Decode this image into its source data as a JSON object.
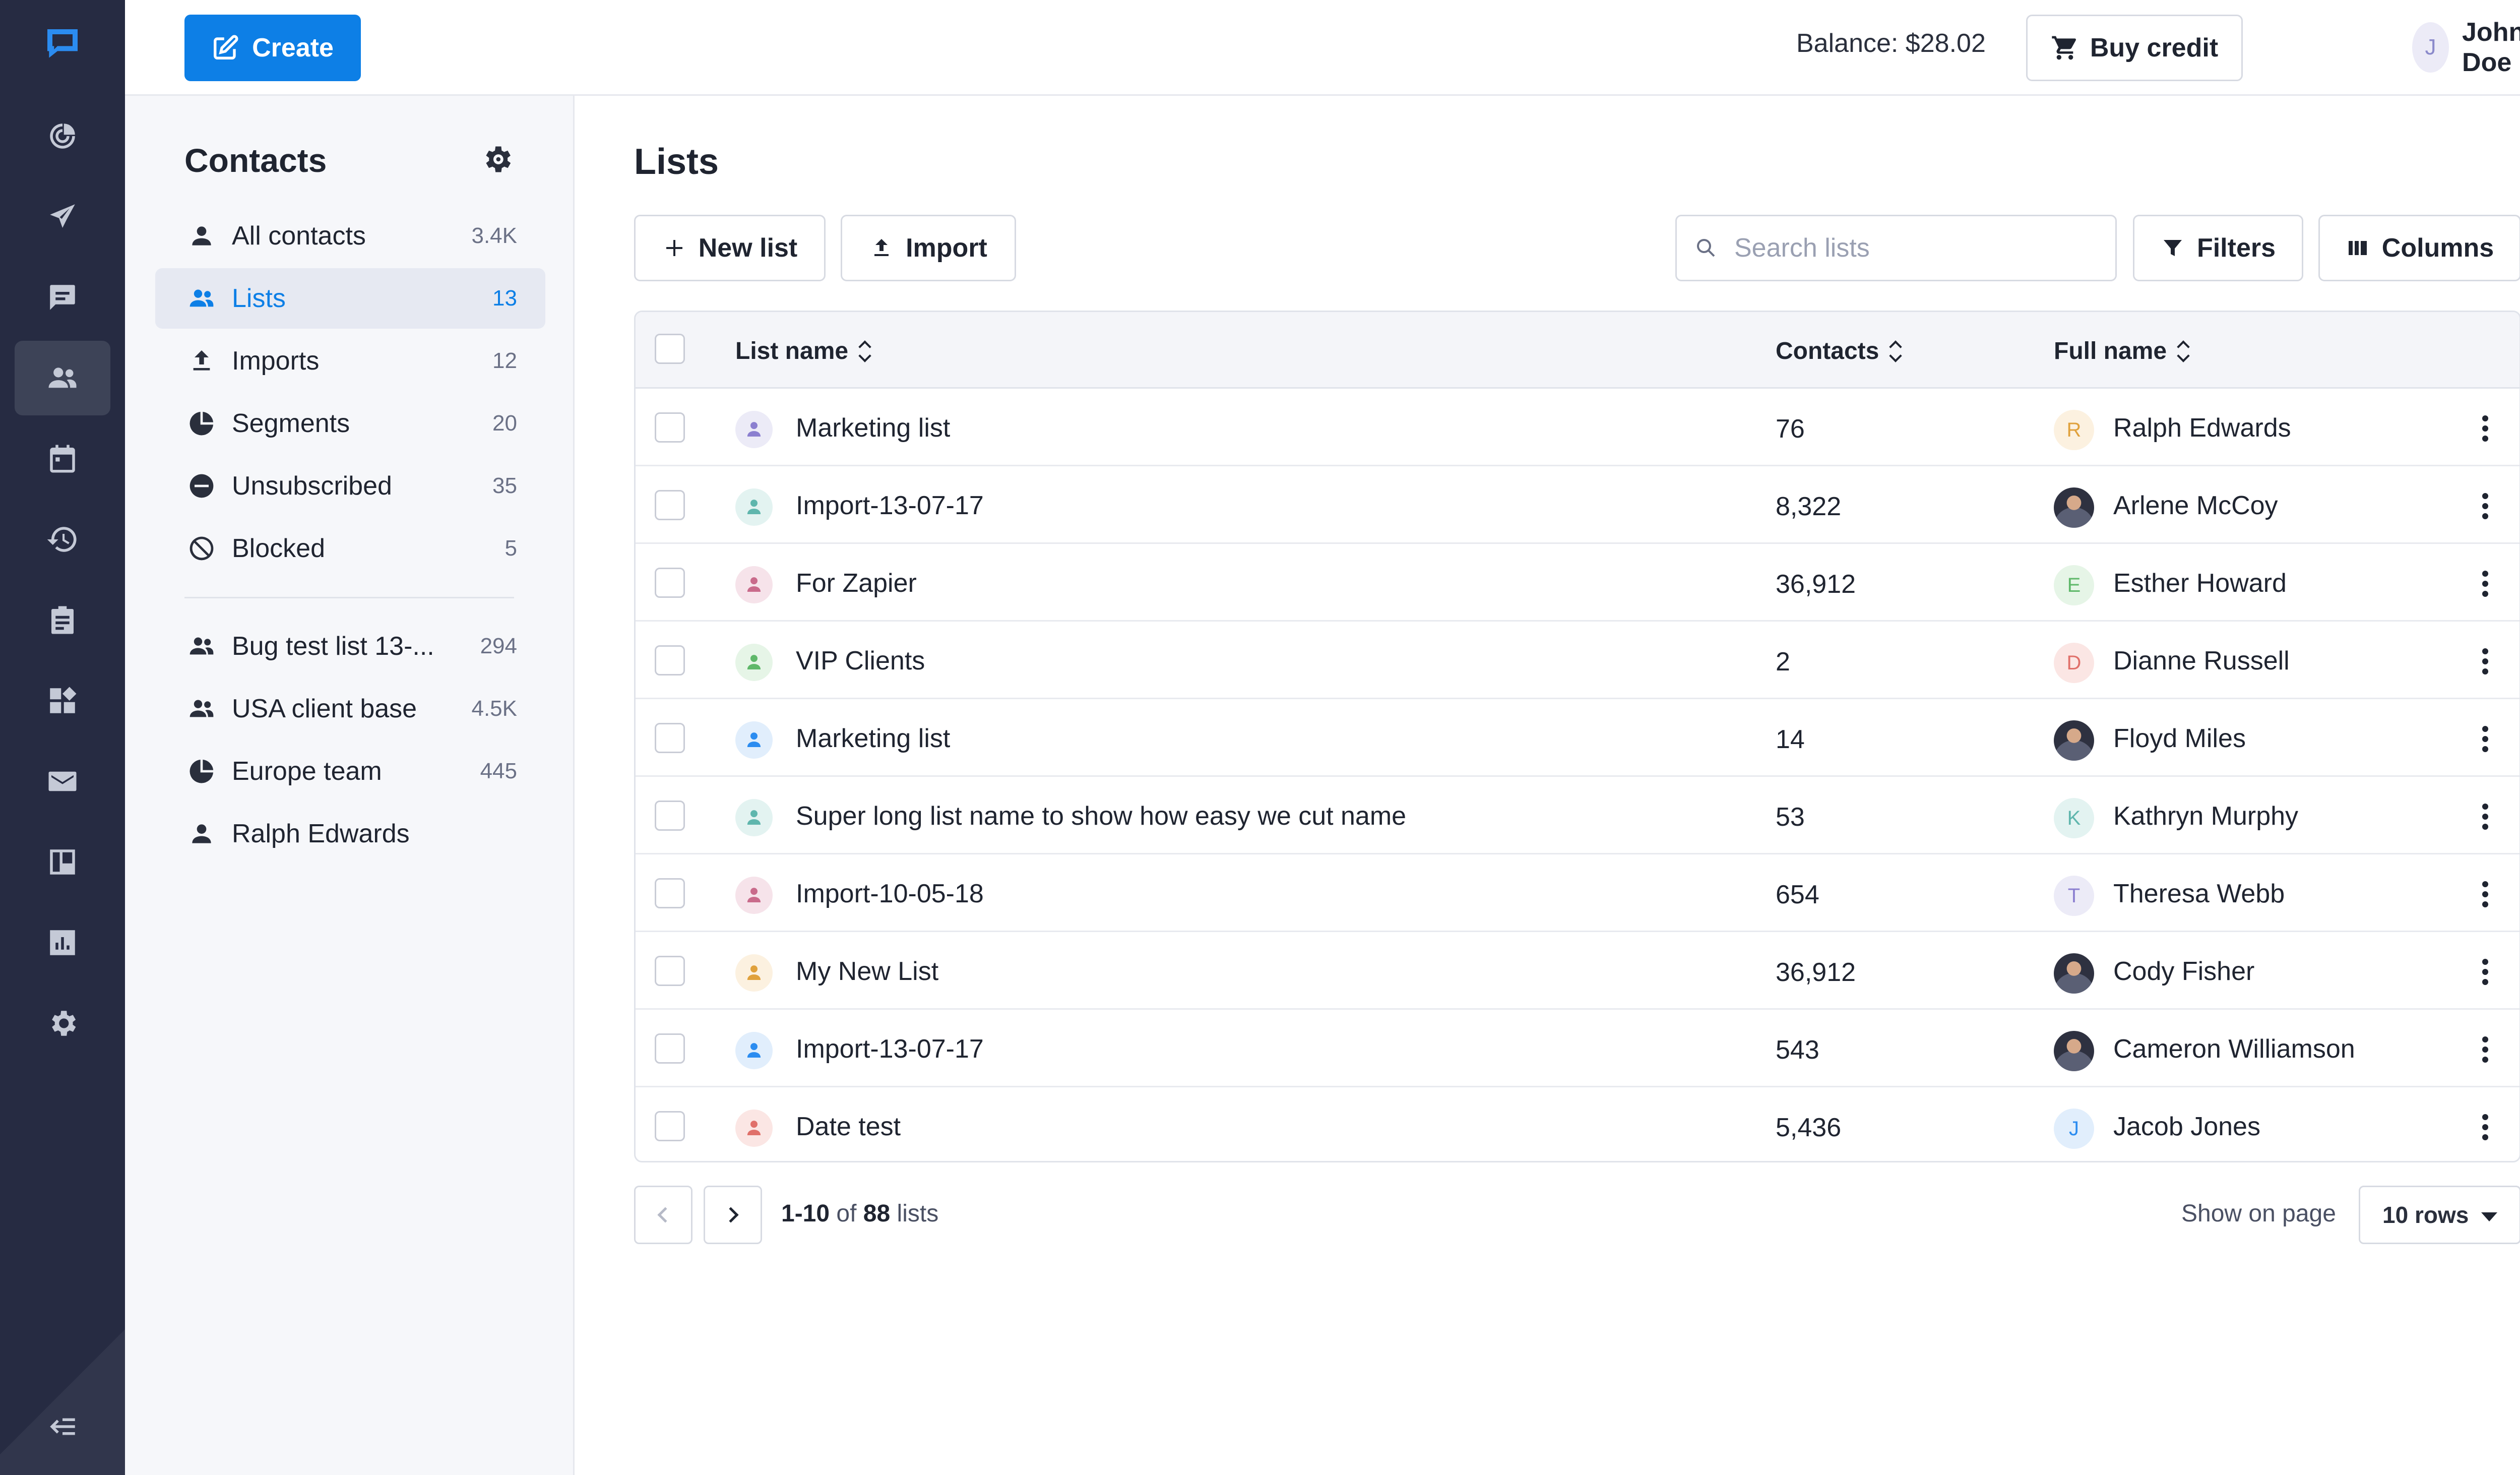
{
  "topbar": {
    "create_label": "Create",
    "balance_label": "Balance: $28.02",
    "buy_credit_label": "Buy credit",
    "user_initial": "J",
    "user_name": "John Doe"
  },
  "rail": {
    "items": [
      "logo-icon",
      "dashboard-icon",
      "send-icon",
      "chat-icon",
      "contacts-icon",
      "calendar-icon",
      "history-icon",
      "clipboard-icon",
      "apps-icon",
      "mail-icon",
      "board-icon",
      "chart-icon",
      "settings-icon",
      "collapse-icon"
    ],
    "active": "contacts-icon"
  },
  "sidebar": {
    "title": "Contacts",
    "items": [
      {
        "label": "All contacts",
        "count": "3.4K",
        "icon": "person-icon"
      },
      {
        "label": "Lists",
        "count": "13",
        "icon": "group-icon"
      },
      {
        "label": "Imports",
        "count": "12",
        "icon": "upload-icon"
      },
      {
        "label": "Segments",
        "count": "20",
        "icon": "pie-icon"
      },
      {
        "label": "Unsubscribed",
        "count": "35",
        "icon": "minus-circle-icon"
      },
      {
        "label": "Blocked",
        "count": "5",
        "icon": "block-icon"
      }
    ],
    "saved": [
      {
        "label": "Bug test list 13-...",
        "count": "294",
        "icon": "group-icon"
      },
      {
        "label": "USA client base",
        "count": "4.5K",
        "icon": "group-icon"
      },
      {
        "label": "Europe team",
        "count": "445",
        "icon": "pie-icon"
      },
      {
        "label": "Ralph Edwards",
        "count": "",
        "icon": "person-icon"
      }
    ]
  },
  "main": {
    "title": "Lists",
    "new_list_label": "New list",
    "import_label": "Import",
    "search_placeholder": "Search lists",
    "filters_label": "Filters",
    "columns_label": "Columns"
  },
  "table": {
    "headers": {
      "list_name": "List name",
      "contacts": "Contacts",
      "full_name": "Full name"
    },
    "rows": [
      {
        "list_name": "Marketing list",
        "contacts": "76",
        "full_name": "Ralph Edwards",
        "initial": "R",
        "icon_color": "#8b7fd0",
        "icon_bg": "#ecebf7",
        "avatar_color": "#e0a13c",
        "avatar_bg": "#fcf1e0",
        "photo": false
      },
      {
        "list_name": "Import-13-07-17",
        "contacts": "8,322",
        "full_name": "Arlene McCoy",
        "initial": "",
        "icon_color": "#5fb6ad",
        "icon_bg": "#e3f3f1",
        "avatar_color": "",
        "avatar_bg": "",
        "photo": true
      },
      {
        "list_name": "For Zapier",
        "contacts": "36,912",
        "full_name": "Esther Howard",
        "initial": "E",
        "icon_color": "#c96b8b",
        "icon_bg": "#f6e3ea",
        "avatar_color": "#5fb86a",
        "avatar_bg": "#e6f5e7",
        "photo": false
      },
      {
        "list_name": "VIP Clients",
        "contacts": "2",
        "full_name": "Dianne Russell",
        "initial": "D",
        "icon_color": "#5fb86a",
        "icon_bg": "#e6f5e7",
        "avatar_color": "#e0706a",
        "avatar_bg": "#fbe6e4",
        "photo": false
      },
      {
        "list_name": "Marketing list",
        "contacts": "14",
        "full_name": "Floyd Miles",
        "initial": "",
        "icon_color": "#2b8cf0",
        "icon_bg": "#e1eefc",
        "avatar_color": "",
        "avatar_bg": "",
        "photo": true
      },
      {
        "list_name": "Super long list name to show how easy we cut name",
        "contacts": "53",
        "full_name": "Kathryn Murphy",
        "initial": "K",
        "icon_color": "#5fb6ad",
        "icon_bg": "#e3f3f1",
        "avatar_color": "#5fb6ad",
        "avatar_bg": "#e3f3f1",
        "photo": false
      },
      {
        "list_name": "Import-10-05-18",
        "contacts": "654",
        "full_name": "Theresa Webb",
        "initial": "T",
        "icon_color": "#c96b8b",
        "icon_bg": "#f6e3ea",
        "avatar_color": "#8b7fd0",
        "avatar_bg": "#ecebf7",
        "photo": false
      },
      {
        "list_name": "My New List",
        "contacts": "36,912",
        "full_name": "Cody Fisher",
        "initial": "",
        "icon_color": "#e0a13c",
        "icon_bg": "#fcf1e0",
        "avatar_color": "",
        "avatar_bg": "",
        "photo": true
      },
      {
        "list_name": "Import-13-07-17",
        "contacts": "543",
        "full_name": "Cameron Williamson",
        "initial": "",
        "icon_color": "#2b8cf0",
        "icon_bg": "#e1eefc",
        "avatar_color": "",
        "avatar_bg": "",
        "photo": true
      },
      {
        "list_name": "Date test",
        "contacts": "5,436",
        "full_name": "Jacob Jones",
        "initial": "J",
        "icon_color": "#e0706a",
        "icon_bg": "#fbe6e4",
        "avatar_color": "#2b8cf0",
        "avatar_bg": "#e1eefc",
        "photo": false
      }
    ]
  },
  "pagination": {
    "range": "1-10",
    "of_label": "of",
    "total": "88",
    "unit": "lists",
    "show_label": "Show on page",
    "rows_value": "10 rows"
  },
  "colors": {
    "accent": "#0d7fe6",
    "rail": "#262b42"
  }
}
